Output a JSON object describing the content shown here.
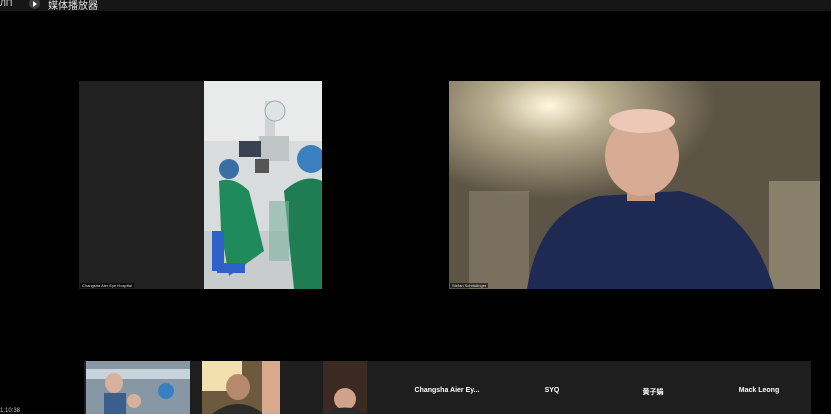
{
  "window": {
    "title": "媒体播放器",
    "edge_label": "ЛП"
  },
  "main_tiles": [
    {
      "name_tag": "Changsha Aier Eye Hospital"
    },
    {
      "name_tag": "Stefan Schrödinger"
    }
  ],
  "participants": [
    {
      "label": "Changsha Aier Ey..."
    },
    {
      "label": "SYQ"
    },
    {
      "label": "黄子娟"
    },
    {
      "label": "Mack Leong"
    }
  ],
  "status": {
    "time": "1:10:38"
  }
}
